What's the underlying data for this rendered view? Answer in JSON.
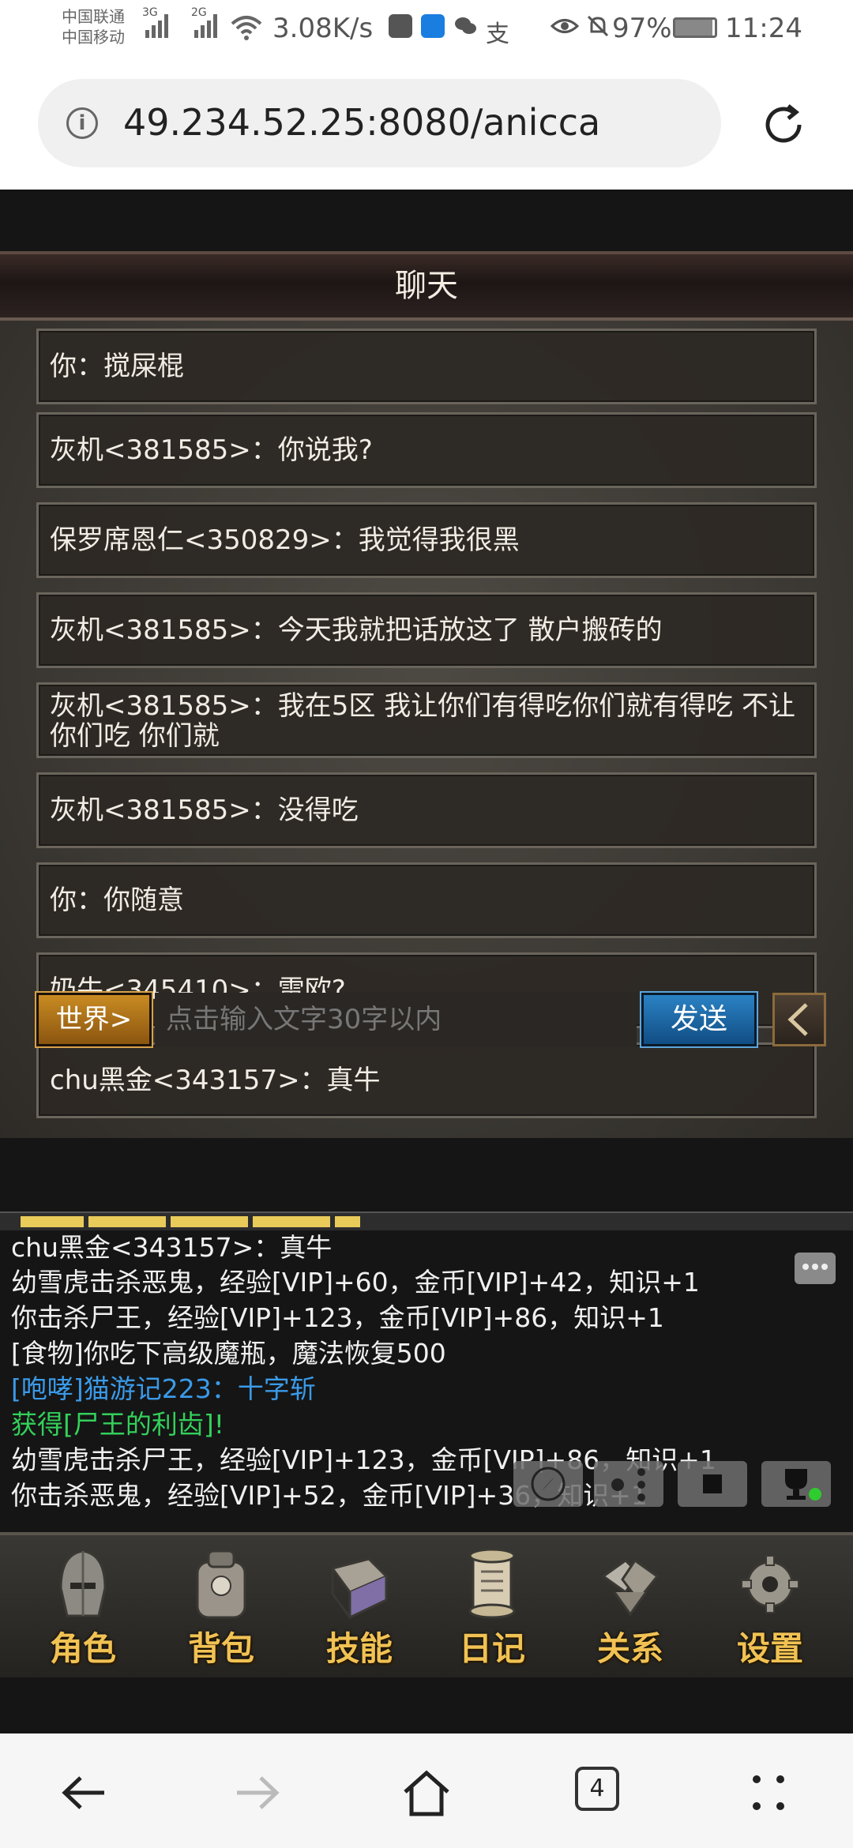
{
  "status_bar": {
    "carrier1": "中国联通",
    "carrier2": "中国移动",
    "sig1_label": "3G",
    "sig2_label": "2G",
    "net_speed": "3.08K/s",
    "battery": "97%",
    "time": "11:24"
  },
  "browser": {
    "url": "49.234.52.25:8080/anicca",
    "tab_count": "4"
  },
  "chat": {
    "title": "聊天",
    "messages": [
      "你：搅屎棍",
      "灰机<381585>：你说我?",
      "保罗席恩仁<350829>：我觉得我很黑",
      "灰机<381585>：今天我就把话放这了 散户搬砖的",
      "灰机<381585>：我在5区 我让你们有得吃你们就有得吃 不让你们吃 你们就",
      "灰机<381585>：没得吃",
      "你：你随意",
      "奶牛<345410>：雷欧?",
      "chu黑金<343157>：真牛"
    ],
    "channel_button": "世界>",
    "input_placeholder": "点击输入文字30字以内",
    "send_button": "发送"
  },
  "log": {
    "lines": [
      "chu黑金<343157>：真牛",
      "幼雪虎击杀恶鬼，经验[VIP]+60，金币[VIP]+42，知识+1",
      "你击杀尸王，经验[VIP]+123，金币[VIP]+86，知识+1",
      "[食物]你吃下高级魔瓶，魔法恢复500",
      "[咆哮]猫游记223：十字斩",
      "获得[尸王的利齿]!",
      "幼雪虎击杀尸王，经验[VIP]+123，金币[VIP]+86，知识+1",
      "你击杀恶鬼，经验[VIP]+52，金币[VIP]+36，知识+1"
    ]
  },
  "game_nav": {
    "items": [
      "角色",
      "背包",
      "技能",
      "日记",
      "关系",
      "设置"
    ]
  },
  "colors": {
    "log_blue": "#3a9ae8",
    "log_green": "#33d05a",
    "nav_gold": "#f1c253"
  }
}
